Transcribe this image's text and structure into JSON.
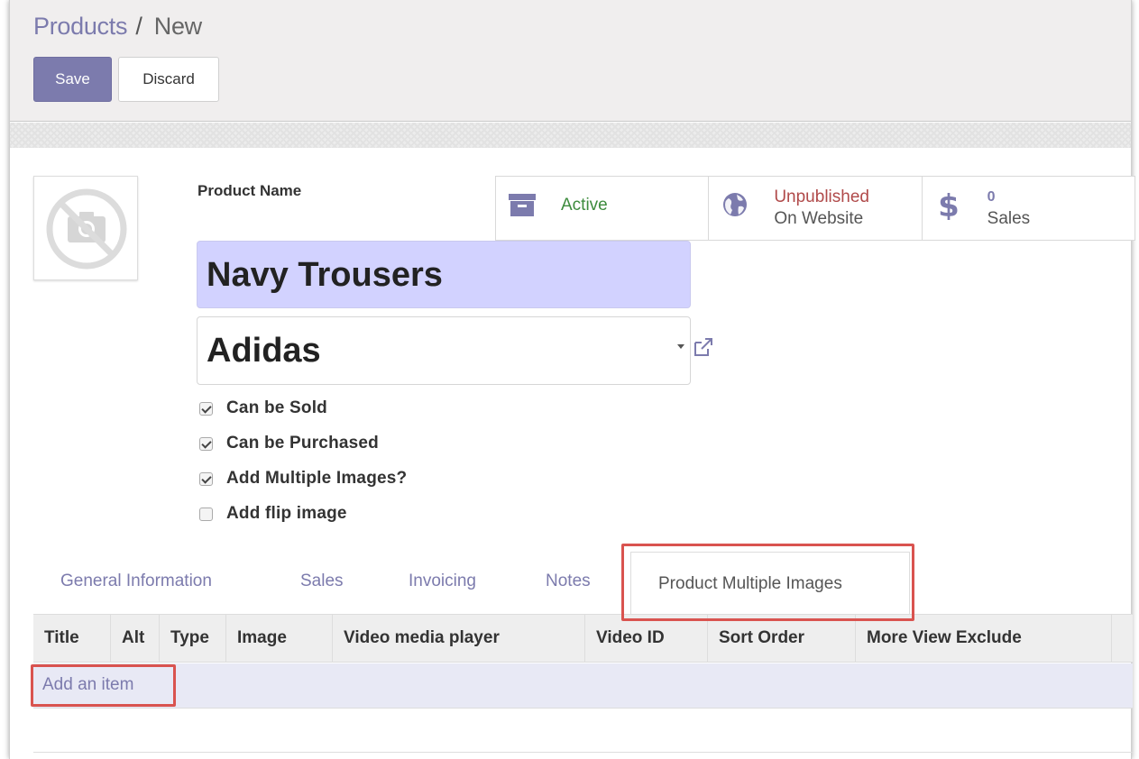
{
  "breadcrumb": {
    "parent": "Products",
    "separator": "/",
    "current": "New"
  },
  "toolbar": {
    "save_label": "Save",
    "discard_label": "Discard"
  },
  "form": {
    "name_label": "Product Name",
    "name_value": "Navy Trousers",
    "brand_value": "Adidas"
  },
  "stats": {
    "active_label": "Active",
    "website_status": "Unpublished",
    "website_label": "On Website",
    "sales_count": "0",
    "sales_label": "Sales"
  },
  "checkboxes": [
    {
      "label": "Can be Sold",
      "checked": true
    },
    {
      "label": "Can be Purchased",
      "checked": true
    },
    {
      "label": "Add Multiple Images?",
      "checked": true
    },
    {
      "label": "Add flip image",
      "checked": false
    }
  ],
  "tabs": [
    "General Information",
    "Sales",
    "Invoicing",
    "Notes",
    "Product Multiple Images"
  ],
  "active_tab": "Product Multiple Images",
  "table": {
    "columns": [
      "Title",
      "Alt",
      "Type",
      "Image",
      "Video media player",
      "Video ID",
      "Sort Order",
      "More View Exclude"
    ],
    "add_item_label": "Add an item"
  },
  "colors": {
    "accent": "#7c7bad",
    "active_green": "#3d8b3d",
    "unpublished_red": "#b04a4a",
    "highlight_red": "#d9534f",
    "name_field_bg": "#d2d2ff"
  },
  "icons": [
    "no-image-camera-icon",
    "archive-icon",
    "globe-icon",
    "dollar-icon",
    "external-link-icon",
    "dropdown-caret-icon"
  ]
}
